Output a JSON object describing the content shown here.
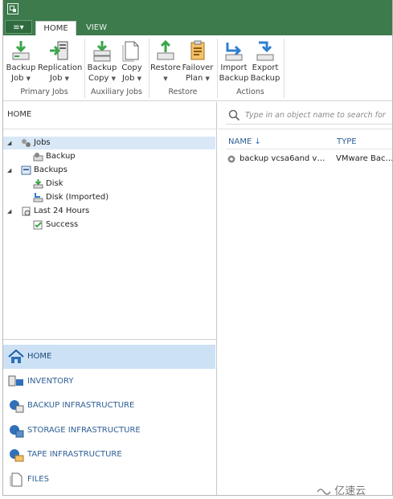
{
  "ribbon": {
    "menu_label": "≡▾",
    "tabs": [
      {
        "label": "HOME"
      },
      {
        "label": "VIEW"
      }
    ],
    "buttons": [
      {
        "line1": "Backup",
        "line2": "Job"
      },
      {
        "line1": "Replication",
        "line2": "Job"
      },
      {
        "line1": "Backup",
        "line2": "Copy"
      },
      {
        "line1": "Copy",
        "line2": "Job"
      },
      {
        "line1": "Restore",
        "line2": ""
      },
      {
        "line1": "Failover",
        "line2": "Plan"
      },
      {
        "line1": "Import",
        "line2": "Backup"
      },
      {
        "line1": "Export",
        "line2": "Backup"
      }
    ],
    "groups": [
      {
        "label": "Primary Jobs"
      },
      {
        "label": "Auxiliary Jobs"
      },
      {
        "label": "Restore"
      },
      {
        "label": "Actions"
      }
    ]
  },
  "left_pane": {
    "breadcrumb": "HOME",
    "tree": [
      {
        "label": "Jobs"
      },
      {
        "label": "Backup"
      },
      {
        "label": "Backups"
      },
      {
        "label": "Disk"
      },
      {
        "label": "Disk (Imported)"
      },
      {
        "label": "Last 24 Hours"
      },
      {
        "label": "Success"
      }
    ],
    "nav": [
      {
        "label": "HOME"
      },
      {
        "label": "INVENTORY"
      },
      {
        "label": "BACKUP INFRASTRUCTURE"
      },
      {
        "label": "STORAGE INFRASTRUCTURE"
      },
      {
        "label": "TAPE INFRASTRUCTURE"
      },
      {
        "label": "FILES"
      }
    ]
  },
  "right_pane": {
    "search_placeholder": "Type in an object name to search for",
    "columns": [
      {
        "label": "NAME"
      },
      {
        "label": "TYPE"
      }
    ],
    "sort_indicator": "↓",
    "rows": [
      {
        "name": "backup vcsa6and vcs...",
        "type": "VMware Back..."
      }
    ]
  },
  "watermark": "亿速云",
  "colors": {
    "title_bar": "#3d7a4c",
    "selection": "#d9e8f7",
    "nav_active": "#cde1f5",
    "link_blue": "#2f5f96"
  }
}
